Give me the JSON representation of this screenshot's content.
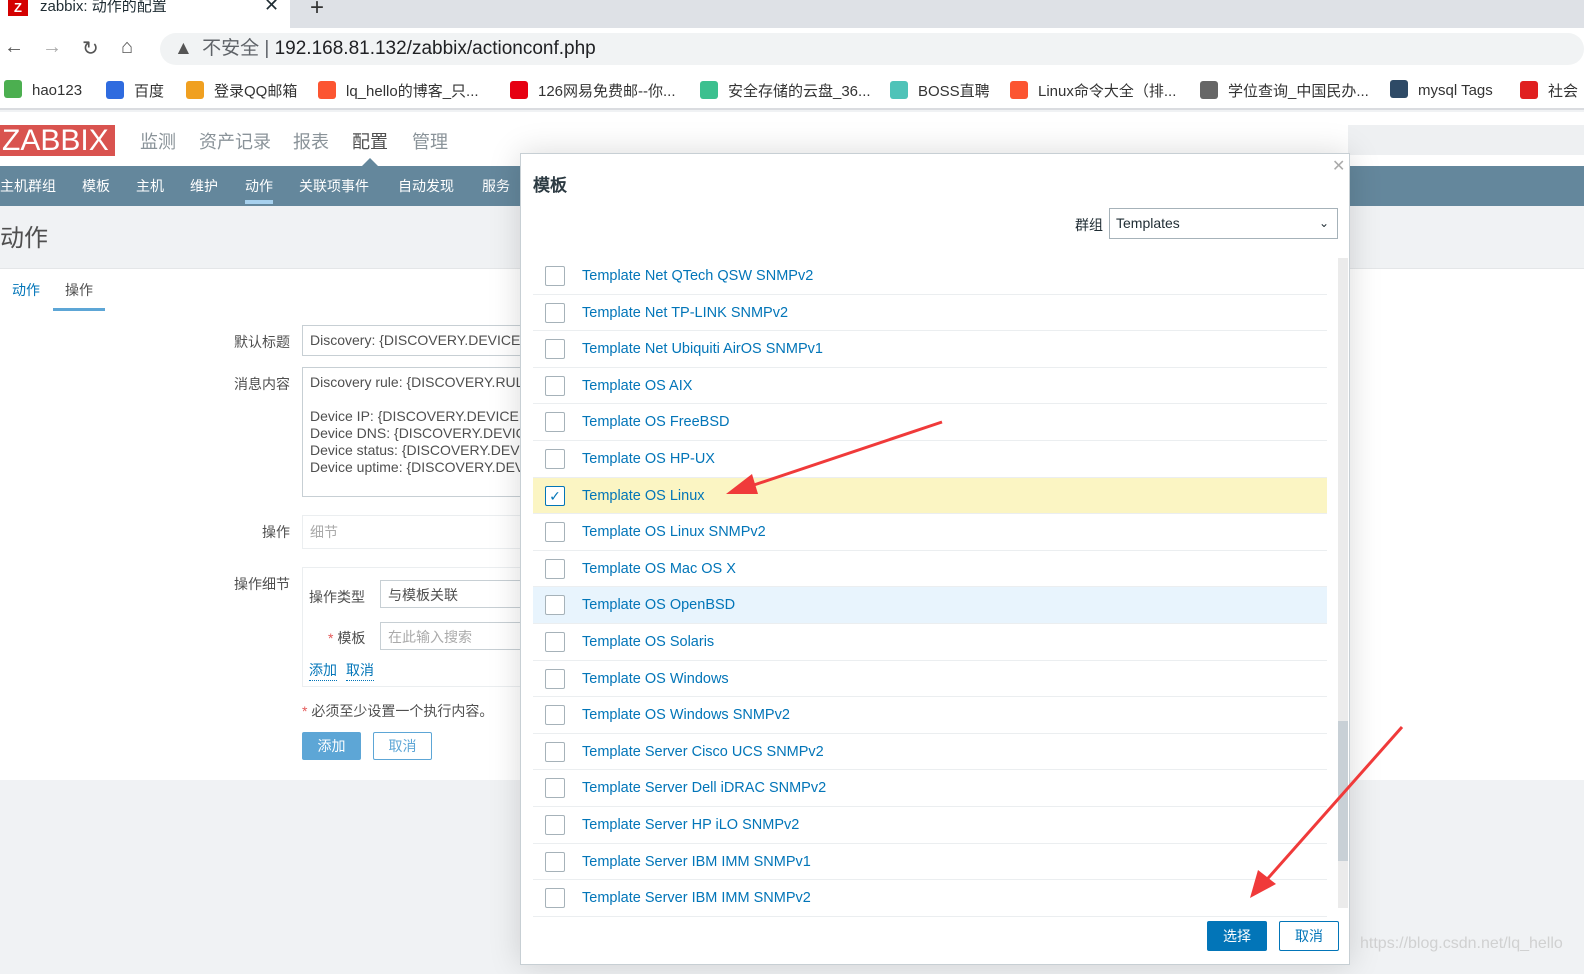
{
  "browser": {
    "tab_title": "zabbix: 动作的配置",
    "tab_favicon": "Z",
    "url_warning": "不安全",
    "url": "192.168.81.132/zabbix/actionconf.php",
    "bookmarks": [
      {
        "label": "hao123",
        "icon": "hao123-icon",
        "color": "#4caf50"
      },
      {
        "label": "百度",
        "icon": "baidu-paw-icon",
        "color": "#2f6bdf"
      },
      {
        "label": "登录QQ邮箱",
        "icon": "qq-mail-icon",
        "color": "#f0a020"
      },
      {
        "label": "lq_hello的博客_只...",
        "icon": "csdn-c-icon",
        "color": "#fc5531"
      },
      {
        "label": "126网易免费邮--你...",
        "icon": "netease-icon",
        "color": "#e60012"
      },
      {
        "label": "安全存储的云盘_36...",
        "icon": "cloud-icon",
        "color": "#3cc08f"
      },
      {
        "label": "BOSS直聘",
        "icon": "boss-b-icon",
        "color": "#4fc3b8"
      },
      {
        "label": "Linux命令大全（排...",
        "icon": "csdn-c-icon",
        "color": "#fc5531"
      },
      {
        "label": "学位查询_中国民办...",
        "icon": "globe-icon",
        "color": "#666666"
      },
      {
        "label": "mysql Tags",
        "icon": "docker-icon",
        "color": "#2e4a66"
      },
      {
        "label": "社会",
        "icon": "flame-icon",
        "color": "#e02020"
      }
    ]
  },
  "zabbix": {
    "logo": "ZABBIX",
    "top_menu": [
      "监测",
      "资产记录",
      "报表",
      "配置",
      "管理"
    ],
    "sub_menu": [
      "主机群组",
      "模板",
      "主机",
      "维护",
      "动作",
      "关联项事件",
      "自动发现",
      "服务"
    ],
    "active_sub": "动作",
    "page_title": "动作",
    "form_tabs": [
      "动作",
      "操作"
    ],
    "default_subject_label": "默认标题",
    "default_subject": "Discovery: {DISCOVERY.DEVICE.STATUS}",
    "message_label": "消息内容",
    "message_lines": [
      "Discovery rule: {DISCOVERY.RULE.NAME}",
      "",
      "Device IP: {DISCOVERY.DEVICE.IPADDRESS}",
      "Device DNS: {DISCOVERY.DEVICE.DNS}",
      "Device status: {DISCOVERY.DEVICE.STATUS}",
      "Device uptime: {DISCOVERY.DEVICE.UPTIME}"
    ],
    "operations_label": "操作",
    "operations_placeholder": "细节",
    "op_details_label": "操作细节",
    "op_type_label": "操作类型",
    "op_type_value": "与模板关联",
    "template_label": "模板",
    "template_placeholder": "在此输入搜索",
    "add_link": "添加",
    "cancel_link": "取消",
    "required_note": "必须至少设置一个执行内容。",
    "add_button": "添加",
    "cancel_button": "取消"
  },
  "modal": {
    "title": "模板",
    "group_label": "群组",
    "group_value": "Templates",
    "items": [
      {
        "label": "Template Net QTech QSW SNMPv2",
        "checked": false
      },
      {
        "label": "Template Net TP-LINK SNMPv2",
        "checked": false
      },
      {
        "label": "Template Net Ubiquiti AirOS SNMPv1",
        "checked": false
      },
      {
        "label": "Template OS AIX",
        "checked": false
      },
      {
        "label": "Template OS FreeBSD",
        "checked": false
      },
      {
        "label": "Template OS HP-UX",
        "checked": false
      },
      {
        "label": "Template OS Linux",
        "checked": true
      },
      {
        "label": "Template OS Linux SNMPv2",
        "checked": false
      },
      {
        "label": "Template OS Mac OS X",
        "checked": false
      },
      {
        "label": "Template OS OpenBSD",
        "checked": false,
        "hover": true
      },
      {
        "label": "Template OS Solaris",
        "checked": false
      },
      {
        "label": "Template OS Windows",
        "checked": false
      },
      {
        "label": "Template OS Windows SNMPv2",
        "checked": false
      },
      {
        "label": "Template Server Cisco UCS SNMPv2",
        "checked": false
      },
      {
        "label": "Template Server Dell iDRAC SNMPv2",
        "checked": false
      },
      {
        "label": "Template Server HP iLO SNMPv2",
        "checked": false
      },
      {
        "label": "Template Server IBM IMM SNMPv1",
        "checked": false
      },
      {
        "label": "Template Server IBM IMM SNMPv2",
        "checked": false
      }
    ],
    "select_button": "选择",
    "cancel_button": "取消"
  },
  "watermark": "https://blog.csdn.net/lq_hello",
  "colors": {
    "zabbix_red": "#d9534f",
    "nav": "#64879c",
    "link": "#0275b8",
    "selected_row": "#fbf5c3",
    "annotation_arrow": "#f03a3a"
  }
}
